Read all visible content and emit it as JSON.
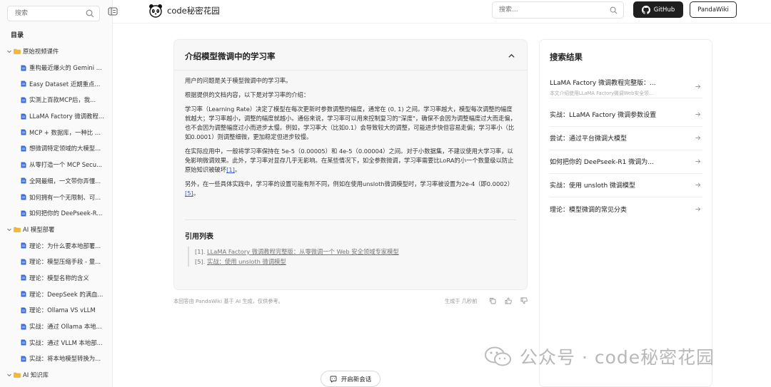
{
  "sidebar": {
    "search_placeholder": "搜索",
    "toc_title": "目录",
    "items": [
      {
        "type": "folder",
        "label": "原始视频课件"
      },
      {
        "type": "doc",
        "label": "重构最近爆火的 Gemini ..."
      },
      {
        "type": "doc",
        "label": "Easy Dataset 近期重点..."
      },
      {
        "type": "doc",
        "label": "实测上百款MCP后，我..."
      },
      {
        "type": "doc",
        "label": "LLaMA Factory 微调教程..."
      },
      {
        "type": "doc",
        "label": "MCP + 数据库，一种比 R..."
      },
      {
        "type": "doc",
        "label": "想微调特定领域的大模型..."
      },
      {
        "type": "doc",
        "label": "从零打造一个 MCP Secu..."
      },
      {
        "type": "doc",
        "label": "全网最细，一文带你弄懂..."
      },
      {
        "type": "doc",
        "label": "如何拥有一个无限制、可..."
      },
      {
        "type": "doc",
        "label": "如何把你的 DeePseek-R..."
      },
      {
        "type": "folder",
        "label": "AI 模型部署"
      },
      {
        "type": "doc",
        "label": "理论：为什么要本地部署..."
      },
      {
        "type": "doc",
        "label": "理论：模型压缩手段 - 量..."
      },
      {
        "type": "doc",
        "label": "理论：模型名称的含义"
      },
      {
        "type": "doc",
        "label": "理论：DeepSeek 的满血..."
      },
      {
        "type": "doc",
        "label": "理论：Ollama VS vLLM"
      },
      {
        "type": "doc",
        "label": "实战：通过 Ollama 本地..."
      },
      {
        "type": "doc",
        "label": "实战：通过 VLLM 本地部..."
      },
      {
        "type": "doc",
        "label": "实战：将本地模型转换为..."
      },
      {
        "type": "folder",
        "label": "AI 知识库"
      }
    ]
  },
  "header": {
    "brand": "code秘密花园",
    "search_placeholder": "搜索...",
    "github_label": "GitHub",
    "pandawiki_label": "PandaWiki"
  },
  "answer": {
    "title": "介绍模型微调中的学习率",
    "p1": "用户的问题是关于模型微调中的学习率。",
    "p2": "根据提供的文档内容，以下是对学习率的介绍：",
    "p3": "学习率（Learning Rate）决定了模型在每次更新时参数调整的幅度，通常在 (0, 1) 之间。学习率越大，模型每次调整的幅度就越大；学习率越小，调整的幅度就越小。通俗来说，学习率可以用来控制复习的\"深度\"，确保不会因为调整幅度过大而走偏，也不会因为调整幅度过小而进步太慢。例如，学习率大（比如0.1）会导致较大的调整，可能进步快但容易走偏；学习率小（比如0.0001）则调整细微，更加稳定但进步较慢。",
    "p4": "在实际应用中，一般将学习率保持在 5e-5（0.00005）和 4e-5（0.00004）之间。对于小数据集，不建议使用大学习率，以免影响微调效果。此外，学习率对显存几乎无影响。在某些情况下，如全参数微调，学习率需要比LoRA的小一个数量级以防止原始知识被破坏",
    "p4_ref": "[1]",
    "p4_end": "。",
    "p5": "另外，在一些具体实践中，学习率的设置可能有所不同，例如在使用unsloth微调模型时，学习率被设置为2e-4（即0.0002）",
    "p5_ref": "[5]",
    "p5_end": "。",
    "refs_title": "引用列表",
    "refs": [
      {
        "num": "[1].",
        "text": "LLaMA Factory 微调教程完整版：从零微调一个 Web 安全领域专家模型"
      },
      {
        "num": "[5].",
        "text": "实战：使用 unsloth 微调模型"
      }
    ]
  },
  "footer": {
    "note": "本回答由 PandaWiki 基于 AI 生成，仅供参考。",
    "generated": "生成于 几秒前"
  },
  "results": {
    "title": "搜索结果",
    "items": [
      {
        "title": "LLaMA Factory 微调教程完整版：...",
        "desc": "本文介绍使用LLaMA Factory微调Web安全领..."
      },
      {
        "title": "实战：LLaMA Factory 微调参数设置",
        "desc": ""
      },
      {
        "title": "尝试：通过平台微调大模型",
        "desc": ""
      },
      {
        "title": "如何把你的 DeePseek-R1 微调为...",
        "desc": ""
      },
      {
        "title": "实战：使用 unsloth 微调模型",
        "desc": ""
      },
      {
        "title": "理论：模型微调的常见分类",
        "desc": ""
      }
    ]
  },
  "watermark": "公众号 · code秘密花园",
  "new_chat_label": "开启新会话"
}
